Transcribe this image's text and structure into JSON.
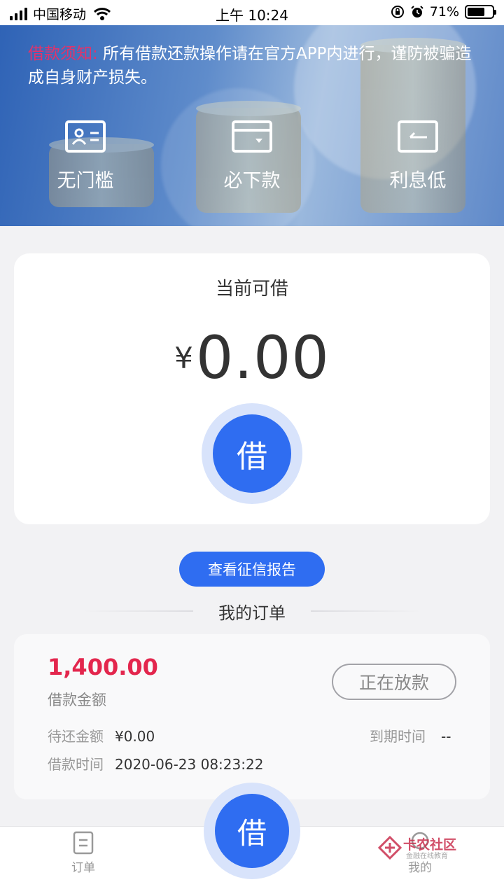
{
  "status_bar": {
    "carrier": "中国移动",
    "time": "上午 10:24",
    "battery": "71%",
    "battery_level": 0.71
  },
  "banner": {
    "notice_label": "借款须知:",
    "notice_text": " 所有借款还款操作请在官方APP内进行，谨防被骗造成自身财产损失。",
    "features": [
      {
        "label": "无门槛",
        "icon": "id-card-icon"
      },
      {
        "label": "必下款",
        "icon": "wallet-icon"
      },
      {
        "label": "利息低",
        "icon": "return-icon"
      }
    ]
  },
  "loan_card": {
    "title": "当前可借",
    "currency": "¥",
    "amount": "0.00",
    "borrow_button": "借"
  },
  "credit_report_button": "查看征信报告",
  "orders_title": "我的订单",
  "order": {
    "amount": "1,400.00",
    "amount_label": "借款金额",
    "status": "正在放款",
    "pending_label": "待还金额",
    "pending_value": "¥0.00",
    "due_label": "到期时间",
    "due_value": "--",
    "time_label": "借款时间",
    "time_value": "2020-06-23 08:23:22"
  },
  "bottom_nav": {
    "orders": "订单",
    "borrow": "借",
    "mine": "我的"
  },
  "watermark": {
    "title": "卡农社区",
    "subtitle": "金融在线教育"
  },
  "colors": {
    "accent": "#2f6df1",
    "alert_red": "#e3264d"
  }
}
